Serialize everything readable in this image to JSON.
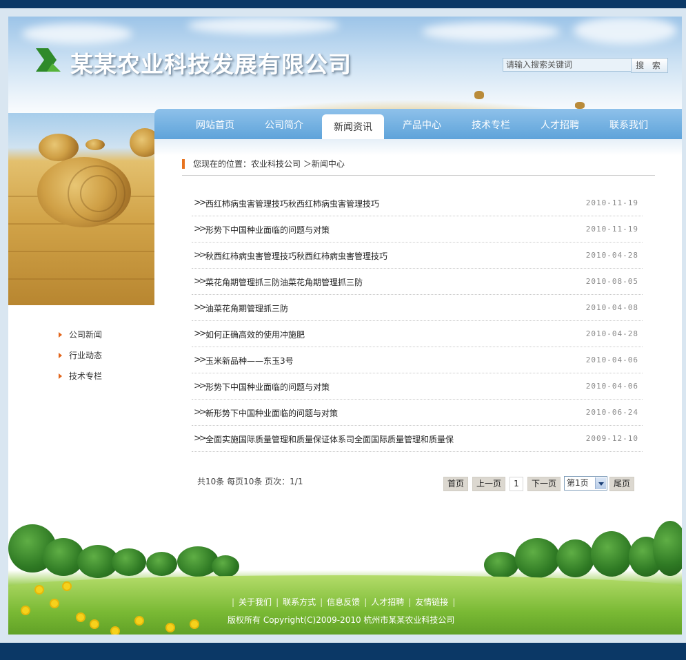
{
  "header": {
    "logo_text": "某某农业科技发展有限公司",
    "search_placeholder": "请输入搜索关键词",
    "search_button": "搜 索"
  },
  "nav": {
    "items": [
      {
        "label": "网站首页",
        "active": false
      },
      {
        "label": "公司简介",
        "active": false
      },
      {
        "label": "新闻资讯",
        "active": true
      },
      {
        "label": "产品中心",
        "active": false
      },
      {
        "label": "技术专栏",
        "active": false
      },
      {
        "label": "人才招聘",
        "active": false
      },
      {
        "label": "联系我们",
        "active": false
      }
    ]
  },
  "sidebar": {
    "items": [
      {
        "label": "公司新闻"
      },
      {
        "label": "行业动态"
      },
      {
        "label": "技术专栏"
      }
    ]
  },
  "breadcrumb": {
    "text": "您现在的位置：农业科技公司 ＞新闻中心"
  },
  "news": [
    {
      "title": "西红柿病虫害管理技巧秋西红柿病虫害管理技巧",
      "date": "2010-11-19"
    },
    {
      "title": "形势下中国种业面临的问题与对策",
      "date": "2010-11-19"
    },
    {
      "title": "秋西红柿病虫害管理技巧秋西红柿病虫害管理技巧",
      "date": "2010-04-28"
    },
    {
      "title": "菜花角期管理抓三防油菜花角期管理抓三防",
      "date": "2010-08-05"
    },
    {
      "title": "油菜花角期管理抓三防",
      "date": "2010-04-08"
    },
    {
      "title": "如何正确高效的使用冲施肥",
      "date": "2010-04-28"
    },
    {
      "title": "玉米新品种——东玉3号",
      "date": "2010-04-06"
    },
    {
      "title": "形势下中国种业面临的问题与对策",
      "date": "2010-04-06"
    },
    {
      "title": "新形势下中国种业面临的问题与对策",
      "date": "2010-06-24"
    },
    {
      "title": "全面实施国际质量管理和质量保证体系司全面国际质量管理和质量保",
      "date": "2009-12-10"
    }
  ],
  "pager": {
    "info": "共10条  每页10条  页次：1/1",
    "first": "首页",
    "prev": "上一页",
    "current": "1",
    "next": "下一页",
    "select_value": "第1页",
    "last": "尾页"
  },
  "footer": {
    "links": [
      "关于我们",
      "联系方式",
      "信息反馈",
      "人才招聘",
      "友情链接"
    ],
    "copyright": "版权所有  Copyright(C)2009-2010 杭州市某某农业科技公司"
  },
  "colors": {
    "nav_blue": "#6aaee0",
    "frame_navy": "#0b3866",
    "accent_orange": "#e8731f"
  }
}
